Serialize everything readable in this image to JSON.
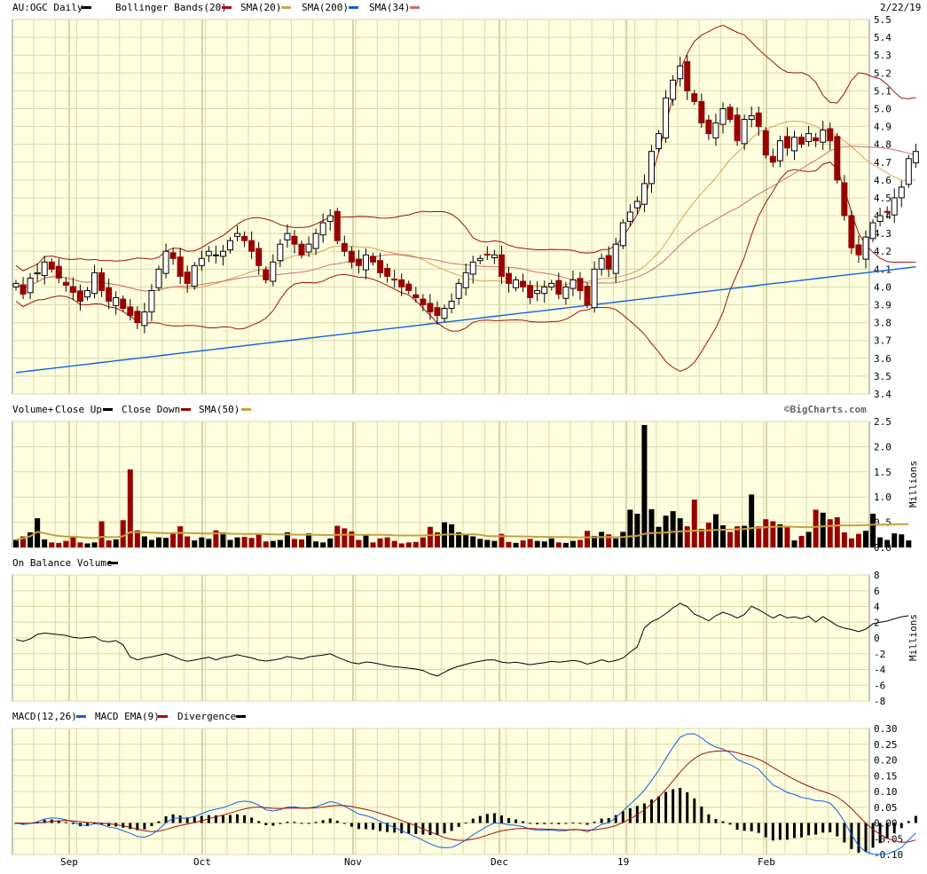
{
  "header": {
    "symbol_label": "AU:OGC Daily",
    "date": "2/22/19",
    "legend": [
      "Bollinger Bands(20)",
      "SMA(20)",
      "SMA(200)",
      "SMA(34)"
    ]
  },
  "colors": {
    "bg": "#ffffe0",
    "grid": "#d8d8a8",
    "up": "#000000",
    "down": "#990000",
    "bollinger": "#a01010",
    "sma20": "#d8a050",
    "sma200": "#1060e0",
    "sma34": "#c87070",
    "vol_sma": "#c8a040",
    "macd": "#1060e0",
    "macd_ema": "#a01010"
  },
  "watermark": "©BigCharts.com",
  "x_axis": {
    "labels": [
      "Sep",
      "Oct",
      "Nov",
      "Dec",
      "19",
      "Feb"
    ]
  },
  "chart_data": [
    {
      "type": "candlestick",
      "name": "price",
      "y_ticks": [
        "5.5",
        "5.4",
        "5.3",
        "5.2",
        "5.1",
        "5.0",
        "4.9",
        "4.8",
        "4.7",
        "4.6",
        "4.5",
        "4.4",
        "4.3",
        "4.2",
        "4.1",
        "4.0",
        "3.9",
        "3.8",
        "3.7",
        "3.6",
        "3.5",
        "3.4"
      ],
      "ylim": [
        3.4,
        5.5
      ],
      "n_days": 120,
      "close": [
        4.02,
        3.96,
        4.05,
        4.08,
        4.14,
        4.1,
        4.05,
        4.01,
        3.97,
        3.92,
        3.98,
        4.08,
        3.98,
        3.92,
        3.94,
        3.88,
        3.84,
        3.8,
        3.86,
        3.98,
        4.1,
        4.2,
        4.16,
        4.06,
        4.02,
        4.12,
        4.16,
        4.2,
        4.18,
        4.2,
        4.26,
        4.3,
        4.26,
        4.2,
        4.12,
        4.04,
        4.14,
        4.24,
        4.3,
        4.24,
        4.18,
        4.24,
        4.3,
        4.36,
        4.4,
        4.26,
        4.2,
        4.14,
        4.12,
        4.18,
        4.14,
        4.08,
        4.06,
        4.04,
        4.0,
        3.98,
        3.94,
        3.9,
        3.86,
        3.84,
        3.88,
        3.92,
        4.02,
        4.08,
        4.14,
        4.16,
        4.18,
        4.18,
        4.06,
        4.02,
        4.04,
        4.0,
        3.94,
        3.98,
        4.0,
        4.02,
        3.96,
        4.0,
        4.04,
        3.98,
        3.9,
        4.1,
        4.16,
        4.1,
        4.24,
        4.36,
        4.42,
        4.48,
        4.58,
        4.76,
        4.86,
        5.06,
        5.16,
        5.24,
        5.1,
        5.04,
        4.92,
        4.86,
        4.92,
        5.0,
        4.94,
        4.82,
        4.94,
        4.96,
        4.9,
        4.74,
        4.7,
        4.82,
        4.78,
        4.84,
        4.8,
        4.86,
        4.82,
        4.88,
        4.82,
        4.6,
        4.4,
        4.22,
        4.18,
        4.28,
        4.36,
        4.4,
        4.42,
        4.5,
        4.56,
        4.72,
        4.76
      ]
    },
    {
      "type": "bar",
      "name": "volume",
      "y_ticks": [
        "2.5",
        "2.0",
        "1.5",
        "1.0",
        "0.5",
        "0.0"
      ],
      "ylabel": "Millions",
      "ylim": [
        0,
        2.5
      ],
      "legend": [
        "Volume+",
        "Close Up",
        "Close Down",
        "SMA(50)"
      ],
      "values": [
        0.15,
        0.22,
        0.3,
        0.58,
        0.16,
        0.1,
        0.09,
        0.13,
        0.22,
        0.1,
        0.08,
        0.1,
        0.52,
        0.14,
        0.16,
        0.54,
        1.55,
        0.34,
        0.22,
        0.15,
        0.2,
        0.19,
        0.3,
        0.42,
        0.22,
        0.14,
        0.2,
        0.17,
        0.34,
        0.3,
        0.15,
        0.2,
        0.21,
        0.19,
        0.28,
        0.12,
        0.13,
        0.15,
        0.3,
        0.17,
        0.16,
        0.28,
        0.12,
        0.1,
        0.18,
        0.43,
        0.38,
        0.32,
        0.15,
        0.24,
        0.1,
        0.18,
        0.2,
        0.13,
        0.08,
        0.1,
        0.11,
        0.2,
        0.41,
        0.3,
        0.5,
        0.46,
        0.3,
        0.26,
        0.22,
        0.17,
        0.15,
        0.13,
        0.27,
        0.11,
        0.09,
        0.14,
        0.17,
        0.13,
        0.12,
        0.18,
        0.1,
        0.09,
        0.13,
        0.15,
        0.33,
        0.23,
        0.31,
        0.26,
        0.18,
        0.31,
        0.75,
        0.67,
        2.43,
        0.76,
        0.41,
        0.63,
        0.72,
        0.58,
        0.42,
        0.95,
        0.37,
        0.49,
        0.66,
        0.44,
        0.31,
        0.42,
        0.43,
        1.05,
        0.42,
        0.56,
        0.52,
        0.46,
        0.43,
        0.14,
        0.23,
        0.31,
        0.75,
        0.69,
        0.56,
        0.6,
        0.3,
        0.18,
        0.27,
        0.33,
        0.67,
        0.2,
        0.15,
        0.28,
        0.26,
        0.14
      ]
    },
    {
      "type": "line",
      "name": "on_balance_volume",
      "title": "On Balance Volume",
      "y_ticks": [
        "8",
        "6",
        "4",
        "2",
        "0",
        "-2",
        "-4",
        "-6",
        "-8"
      ],
      "ylabel": "Millions",
      "ylim": [
        -8,
        8
      ]
    },
    {
      "type": "bar+line",
      "name": "macd",
      "y_ticks": [
        "0.30",
        "0.25",
        "0.20",
        "0.15",
        "0.10",
        "0.05",
        "0.00",
        "-0.05",
        "-0.10"
      ],
      "ylim": [
        -0.1,
        0.3
      ],
      "legend": [
        "MACD(12,26)",
        "MACD EMA(9)",
        "Divergence"
      ]
    }
  ]
}
